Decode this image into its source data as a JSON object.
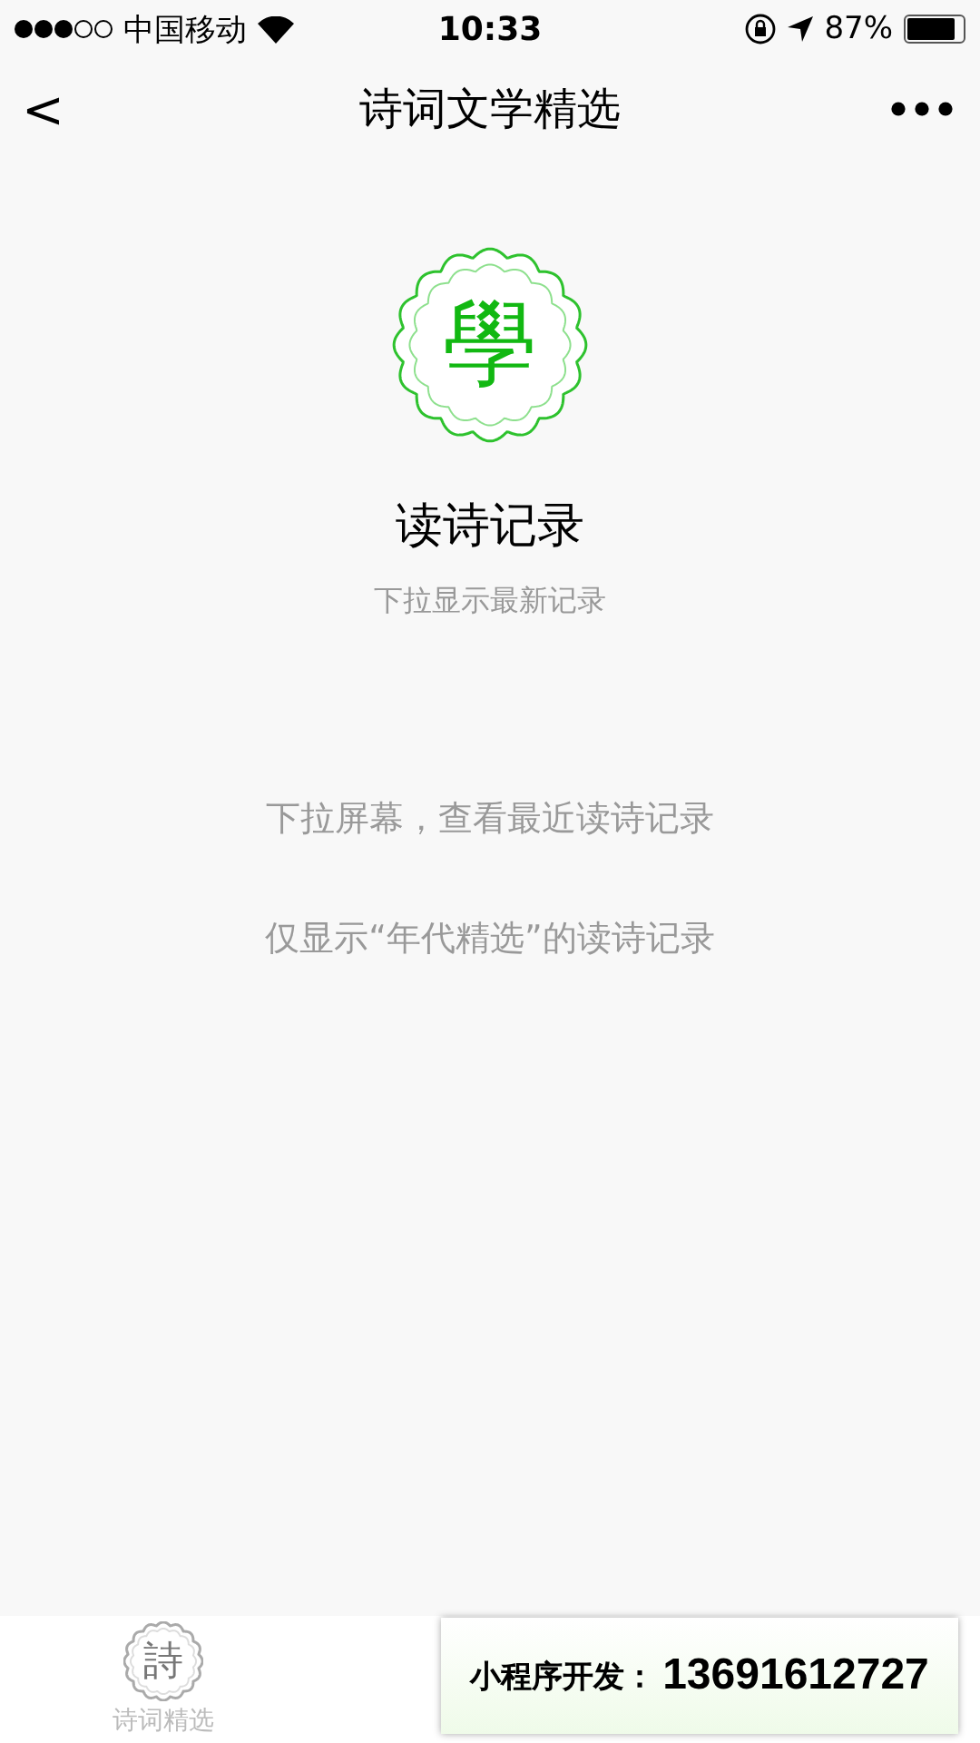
{
  "status_bar": {
    "carrier": "中国移动",
    "time": "10:33",
    "battery": "87%"
  },
  "nav_bar": {
    "back": "<",
    "title": "诗词文学精选"
  },
  "header": {
    "logo_char": "學",
    "title": "读诗记录",
    "subtitle": "下拉显示最新记录"
  },
  "hints": [
    "下拉屏幕，查看最近读诗记录",
    "仅显示“年代精选”的读诗记录"
  ],
  "tab_bar": {
    "tabs": [
      {
        "icon_char": "詩",
        "label": "诗词精选",
        "selected": false
      }
    ]
  },
  "overlay_banner": {
    "label": "小程序开发：",
    "phone": "13691612727"
  }
}
